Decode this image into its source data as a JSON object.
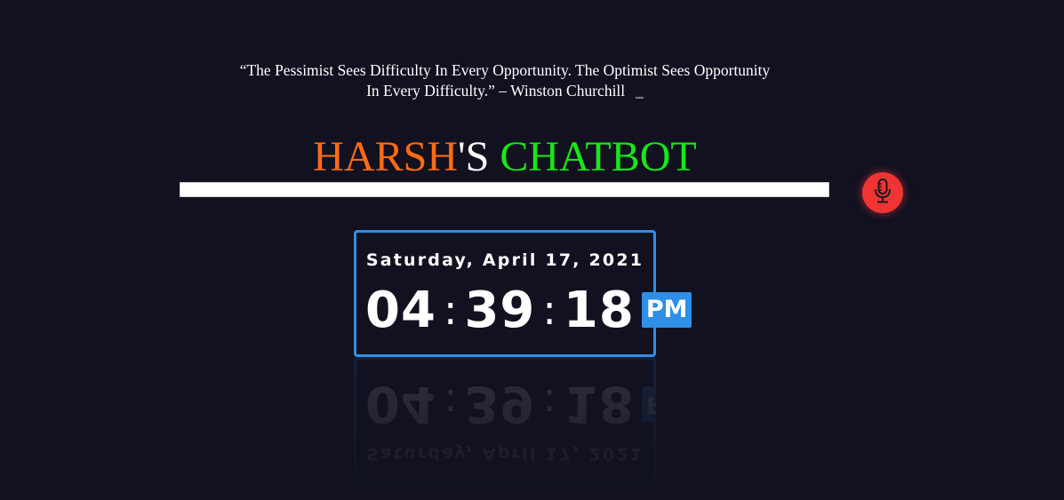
{
  "quote": {
    "text": "“The Pessimist Sees Difficulty In Every Opportunity. The Optimist Sees Opportunity In Every Difficulty.” – Winston Churchill",
    "cursor": "_"
  },
  "title": {
    "part1": "HARSH",
    "part2": "'S",
    "part3": " CHATBOT",
    "colors": {
      "part1": "#ff6a13",
      "part2": "#ffffff",
      "part3": "#19e619"
    }
  },
  "chat_input": {
    "value": "",
    "placeholder": ""
  },
  "mic": {
    "icon": "microphone-icon",
    "color": "#f03434"
  },
  "clock": {
    "date": "Saturday, April 17, 2021",
    "hours": "04",
    "minutes": "39",
    "seconds": "18",
    "separator": ":",
    "ampm": "PM",
    "accent_color": "#2f8fe6"
  }
}
